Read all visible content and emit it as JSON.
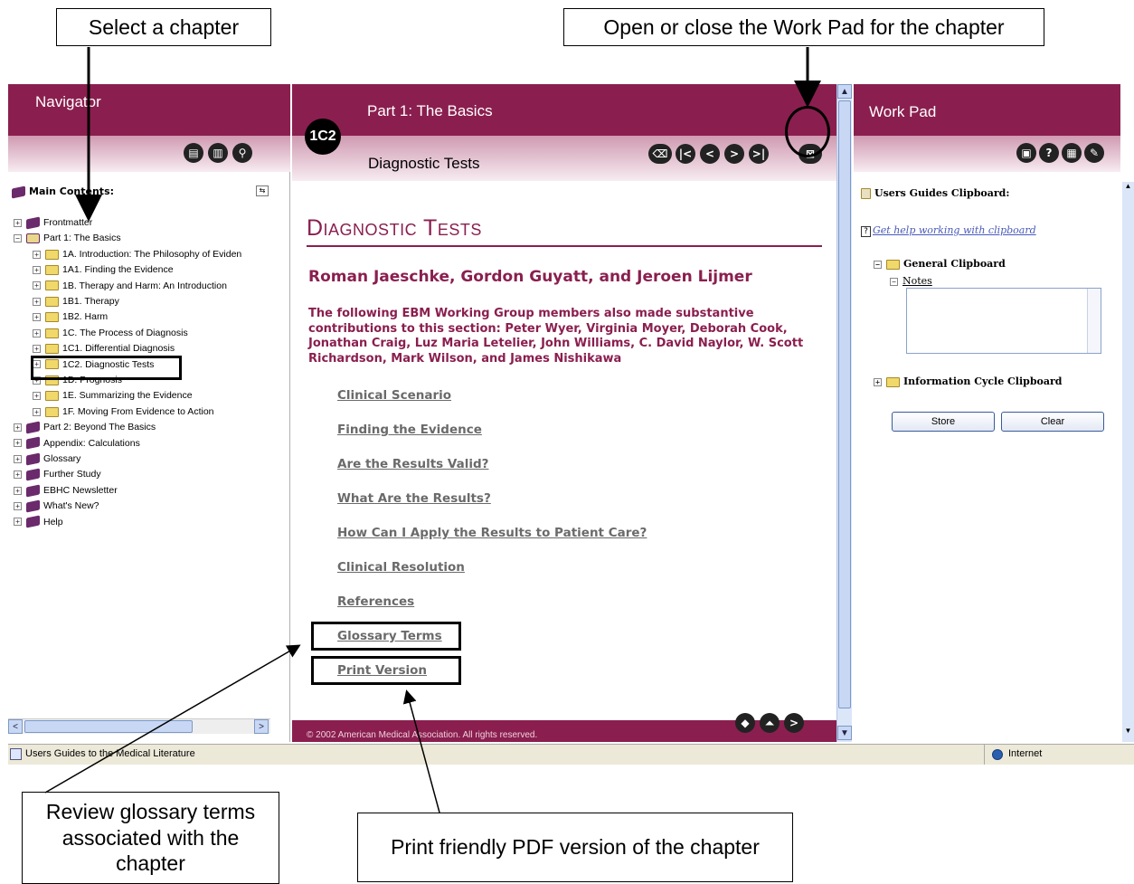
{
  "callouts": {
    "select_chapter": "Select a chapter",
    "workpad_toggle": "Open or close the Work Pad for the chapter",
    "glossary": "Review glossary terms associated with the chapter",
    "print": "Print friendly PDF version of the chapter"
  },
  "navigator": {
    "title": "Navigator",
    "main_contents_label": "Main Contents:",
    "tree": [
      {
        "label": "Frontmatter",
        "icon": "book-icon",
        "level": 0
      },
      {
        "label": "Part 1: The Basics",
        "icon": "open-book-icon",
        "level": 0
      },
      {
        "label": "1A. Introduction: The Philosophy of Eviden",
        "icon": "folder-icon",
        "level": 1
      },
      {
        "label": "1A1. Finding the Evidence",
        "icon": "folder-icon",
        "level": 1
      },
      {
        "label": "1B. Therapy and Harm: An Introduction",
        "icon": "folder-icon",
        "level": 1
      },
      {
        "label": "1B1. Therapy",
        "icon": "folder-icon",
        "level": 1
      },
      {
        "label": "1B2. Harm",
        "icon": "folder-icon",
        "level": 1
      },
      {
        "label": "1C. The Process of Diagnosis",
        "icon": "folder-icon",
        "level": 1
      },
      {
        "label": "1C1. Differential Diagnosis",
        "icon": "folder-icon",
        "level": 1
      },
      {
        "label": "1C2. Diagnostic Tests",
        "icon": "folder-icon",
        "level": 1
      },
      {
        "label": "1D. Prognosis",
        "icon": "folder-icon",
        "level": 1
      },
      {
        "label": "1E. Summarizing the Evidence",
        "icon": "folder-icon",
        "level": 1
      },
      {
        "label": "1F. Moving From Evidence to Action",
        "icon": "folder-icon",
        "level": 1
      },
      {
        "label": "Part 2: Beyond The Basics",
        "icon": "book-icon",
        "level": 0
      },
      {
        "label": "Appendix: Calculations",
        "icon": "book-icon",
        "level": 0
      },
      {
        "label": "Glossary",
        "icon": "book-icon",
        "level": 0
      },
      {
        "label": "Further Study",
        "icon": "book-icon",
        "level": 0
      },
      {
        "label": "EBHC Newsletter",
        "icon": "book-icon",
        "level": 0
      },
      {
        "label": "What's New?",
        "icon": "book-icon",
        "level": 0
      },
      {
        "label": "Help",
        "icon": "book-icon",
        "level": 0
      }
    ]
  },
  "content": {
    "part_title": "Part 1: The Basics",
    "chapter_badge": "1C2",
    "chapter_subtitle": "Diagnostic Tests",
    "doc_title": "Diagnostic Tests",
    "authors": "Roman Jaeschke, Gordon Guyatt, and Jeroen Lijmer",
    "contributors": "The following EBM Working Group members also made substantive contributions to this section: Peter Wyer, Virginia Moyer, Deborah Cook, Jonathan Craig, Luz Maria Letelier, John Williams, C. David Naylor, W. Scott Richardson, Mark Wilson, and James Nishikawa",
    "toc": [
      "Clinical Scenario",
      "Finding the Evidence",
      "Are the Results Valid?",
      "What Are the Results?",
      "How Can I Apply the Results to Patient Care?",
      "Clinical Resolution",
      "References",
      "Glossary Terms",
      "Print Version"
    ],
    "footer": "© 2002 American Medical Association. All rights reserved."
  },
  "workpad": {
    "title": "Work Pad",
    "clipboard_header": "Users Guides Clipboard:",
    "help_link": "Get help working with clipboard",
    "general_clipboard": "General Clipboard",
    "notes_label": "Notes",
    "info_cycle": "Information Cycle Clipboard",
    "store_label": "Store",
    "clear_label": "Clear"
  },
  "status": {
    "left": "Users Guides to the Medical Literature",
    "zone": "Internet"
  },
  "colors": {
    "maroon": "#8a1f4f",
    "link_gray": "#6a6a6a"
  }
}
